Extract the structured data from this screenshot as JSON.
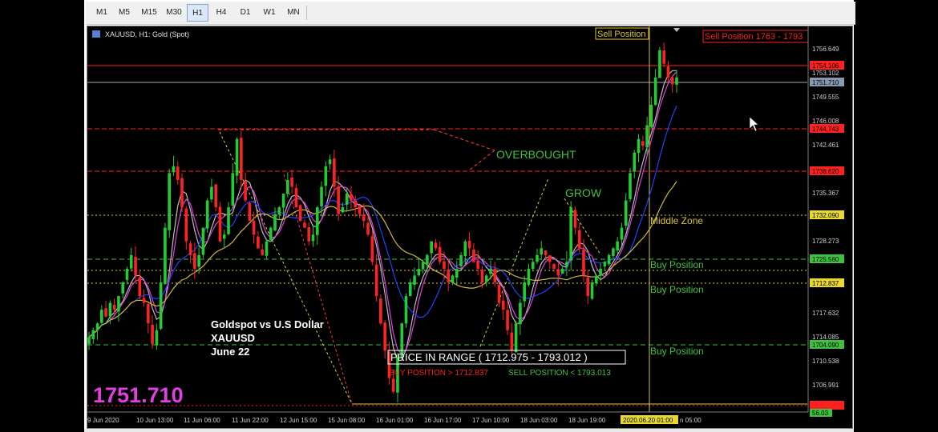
{
  "timeframes": [
    {
      "label": "M1",
      "active": false
    },
    {
      "label": "M5",
      "active": false
    },
    {
      "label": "M15",
      "active": false
    },
    {
      "label": "M30",
      "active": false
    },
    {
      "label": "H1",
      "active": true
    },
    {
      "label": "H4",
      "active": false
    },
    {
      "label": "D1",
      "active": false
    },
    {
      "label": "W1",
      "active": false
    },
    {
      "label": "MN",
      "active": false
    }
  ],
  "chart": {
    "title": "XAUUSD, H1:  Gold (Spot)",
    "current_price_big": "1751.710",
    "info_lines": [
      "Goldspot vs U.S Dollar",
      "XAUUSD",
      "June 22"
    ],
    "annotations": {
      "overbought": "OVERBOUGHT",
      "grow": "GROW",
      "middle_zone": "Middle Zone",
      "buy_position": "Buy Position",
      "sell_position": "Sell Position",
      "sell_box": "Sell Position 1763 - 1793",
      "range_title": "PRICE IN RANGE     ( 1712.975 - 1793.012 )",
      "range_buy": "BUY POSITION > 1712.837",
      "range_sell": "SELL POSITION < 1793.013"
    },
    "cursor_time_label": "2020.06.20 01:00",
    "last_time_label": "n 05:00",
    "colors": {
      "background": "#000000",
      "bull": "#22cc33",
      "bear": "#ff2222",
      "doji": "#c8c8c8",
      "ma_fast": "#e040e0",
      "ma_mid": "#2040ff",
      "ma_slow": "#d4b83a",
      "ma_white": "#bcbcbc",
      "level_red": "#ff2020",
      "level_yellow": "#d8d040",
      "level_green": "#40c040"
    }
  },
  "chart_data": {
    "type": "candlestick",
    "symbol": "XAUUSD",
    "timeframe": "H1",
    "y_ticks": [
      "1756.649",
      "1753.102",
      "1749.555",
      "1746.008",
      "1742.461",
      "1735.367",
      "1728.273",
      "1717.632",
      "1714.085",
      "1710.538",
      "1706.991"
    ],
    "ylim": [
      1703.5,
      1758.3
    ],
    "x_labels": [
      "9 Jun 2020",
      "10 Jun 13:00",
      "11 Jun 06:00",
      "11 Jun 22:00",
      "12 Jun 15:00",
      "15 Jun 08:00",
      "16 Jun 01:00",
      "16 Jun 17:00",
      "17 Jun 10:00",
      "18 Jun 03:00",
      "18 Jun 19:00"
    ],
    "levels": [
      {
        "label": "1754.106",
        "price": 1754.106,
        "color": "red",
        "style": "solid"
      },
      {
        "label": "1751.710",
        "price": 1751.71,
        "color": "grey",
        "style": "solid"
      },
      {
        "label": "1744.743",
        "price": 1744.743,
        "color": "red",
        "style": "dashed"
      },
      {
        "label": "1738.620",
        "price": 1738.62,
        "color": "red",
        "style": "dashed"
      },
      {
        "label": "1732.090",
        "price": 1732.09,
        "color": "yellow",
        "style": "dotted"
      },
      {
        "label": "1725.560",
        "price": 1725.56,
        "color": "green",
        "style": "dashed"
      },
      {
        "label": "1721.575",
        "price": 1721.575,
        "color": "yellow",
        "style": "dotted"
      },
      {
        "label": "1712.837",
        "price": 1712.837,
        "color": "green",
        "style": "dashed"
      },
      {
        "label": "1704.090",
        "price": 1704.09,
        "color": "red",
        "style": "dotted"
      }
    ],
    "extra_axis_label": "56.03",
    "close_path": [
      1714,
      1715,
      1716,
      1718,
      1717,
      1719,
      1718,
      1720,
      1722,
      1724,
      1726,
      1723,
      1720,
      1719,
      1716,
      1713,
      1715,
      1722,
      1730,
      1738,
      1739,
      1737,
      1733,
      1728,
      1726,
      1724,
      1726,
      1730,
      1734,
      1736,
      1733,
      1728,
      1729,
      1733,
      1738,
      1743,
      1737,
      1734,
      1731,
      1729,
      1727,
      1726,
      1728,
      1730,
      1732,
      1733,
      1735,
      1737,
      1736,
      1733,
      1731,
      1730,
      1728,
      1729,
      1733,
      1736,
      1739,
      1740,
      1736,
      1732,
      1733,
      1735,
      1734,
      1733,
      1732,
      1731,
      1729,
      1725,
      1720,
      1716,
      1712,
      1708,
      1706,
      1711,
      1716,
      1720,
      1722,
      1723,
      1724,
      1725,
      1726,
      1728,
      1727,
      1725,
      1724,
      1722,
      1723,
      1724,
      1726,
      1728,
      1727,
      1725,
      1724,
      1722,
      1723,
      1724,
      1722,
      1719,
      1718,
      1715,
      1712,
      1716,
      1719,
      1722,
      1724,
      1725,
      1726,
      1727,
      1726,
      1725,
      1724,
      1723,
      1724,
      1725,
      1733,
      1730,
      1727,
      1723,
      1720,
      1722,
      1723,
      1724,
      1725,
      1726,
      1727,
      1728,
      1730,
      1734,
      1738,
      1741,
      1743,
      1742,
      1745,
      1748,
      1752,
      1756,
      1754,
      1752,
      1751,
      1752
    ]
  }
}
